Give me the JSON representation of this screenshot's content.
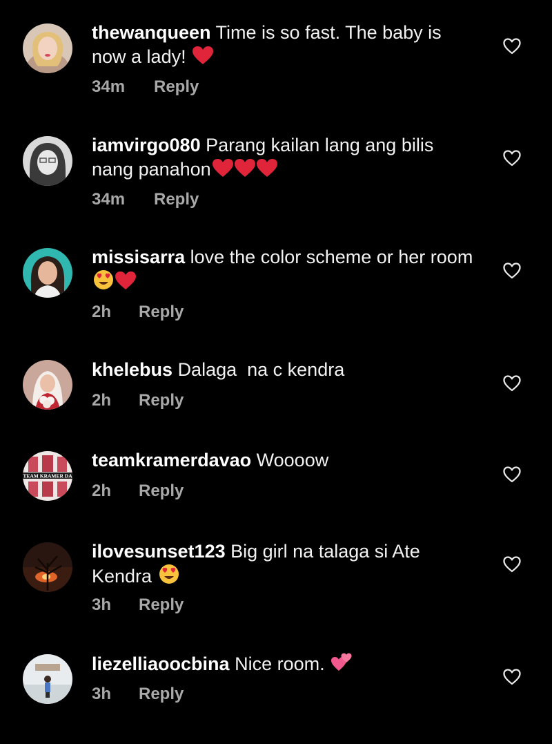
{
  "colors": {
    "background": "#000000",
    "text": "#f2f2f2",
    "muted": "#a8a8a8",
    "heart_red": "#e0243a",
    "heart_pink": "#f25a8f"
  },
  "comments": [
    {
      "username": "thewanqueen",
      "text": "Time is so fast. The baby is now a lady!",
      "emojis": [
        "red-heart"
      ],
      "time": "34m",
      "reply_label": "Reply",
      "avatar_icon": "avatar-woman-portrait",
      "like_icon": "heart-outline-icon"
    },
    {
      "username": "iamvirgo080",
      "text": "Parang kailan lang ang bilis nang panahon",
      "emojis": [
        "red-heart",
        "red-heart",
        "red-heart"
      ],
      "time": "34m",
      "reply_label": "Reply",
      "avatar_icon": "avatar-grayscale-portrait",
      "like_icon": "heart-outline-icon"
    },
    {
      "username": "missisarra",
      "text": "love the color scheme or her room",
      "emojis": [
        "heart-eyes",
        "red-heart"
      ],
      "time": "2h",
      "reply_label": "Reply",
      "avatar_icon": "avatar-woman-teal",
      "like_icon": "heart-outline-icon"
    },
    {
      "username": "khelebus",
      "text": "Dalaga  na c kendra",
      "emojis": [],
      "time": "2h",
      "reply_label": "Reply",
      "avatar_icon": "avatar-bride-flowers",
      "like_icon": "heart-outline-icon"
    },
    {
      "username": "teamkramerdavao",
      "text": "Woooow",
      "emojis": [],
      "time": "2h",
      "reply_label": "Reply",
      "avatar_icon": "avatar-fan-club-banner",
      "avatar_text": "TEAM KRAMER DA",
      "like_icon": "heart-outline-icon"
    },
    {
      "username": "ilovesunset123",
      "text": "Big girl na talaga si Ate Kendra",
      "emojis": [
        "heart-eyes"
      ],
      "time": "3h",
      "reply_label": "Reply",
      "avatar_icon": "avatar-sunset-tree",
      "like_icon": "heart-outline-icon"
    },
    {
      "username": "liezelliaoocbina",
      "text": "Nice room.",
      "emojis": [
        "two-hearts"
      ],
      "time": "3h",
      "reply_label": "Reply",
      "avatar_icon": "avatar-person-outdoor",
      "like_icon": "heart-outline-icon"
    }
  ]
}
